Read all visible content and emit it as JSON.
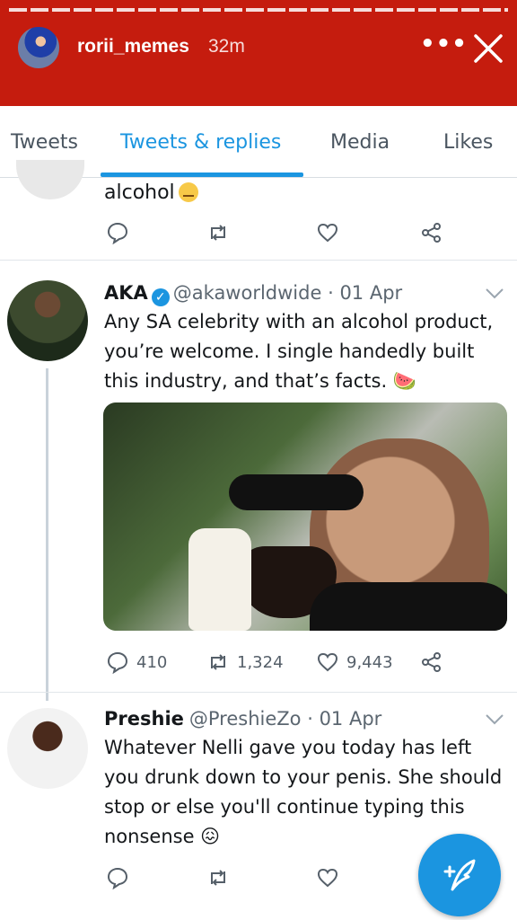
{
  "story": {
    "username": "rorii_memes",
    "time": "32m",
    "more_icon": "more-horizontal-icon",
    "close_icon": "close-icon"
  },
  "tabs": [
    {
      "label": "Tweets",
      "active": false
    },
    {
      "label": "Tweets & replies",
      "active": true
    },
    {
      "label": "Media",
      "active": false
    },
    {
      "label": "Likes",
      "active": false
    }
  ],
  "partial_tweet": {
    "text": "alcohol",
    "emoji": "unamused-face"
  },
  "tweet_aka": {
    "name": "AKA",
    "handle": "@akaworldwide",
    "date": "01 Apr",
    "text": "Any SA celebrity with an alcohol product, you’re welcome. I single handedly built this industry, and that’s facts. 🍉",
    "replies": "410",
    "retweets": "1,324",
    "likes": "9,443"
  },
  "tweet_preshie": {
    "name": "Preshie",
    "handle": "@PreshieZo",
    "date": "01 Apr",
    "text": "Whatever Nelli gave you today has left you drunk down to your penis. She should stop or else you'll continue typing this nonsense 😖"
  },
  "colors": {
    "story_header": "#c51c0e",
    "accent": "#1b95e0",
    "text": "#14171a",
    "muted": "#5b6670"
  }
}
